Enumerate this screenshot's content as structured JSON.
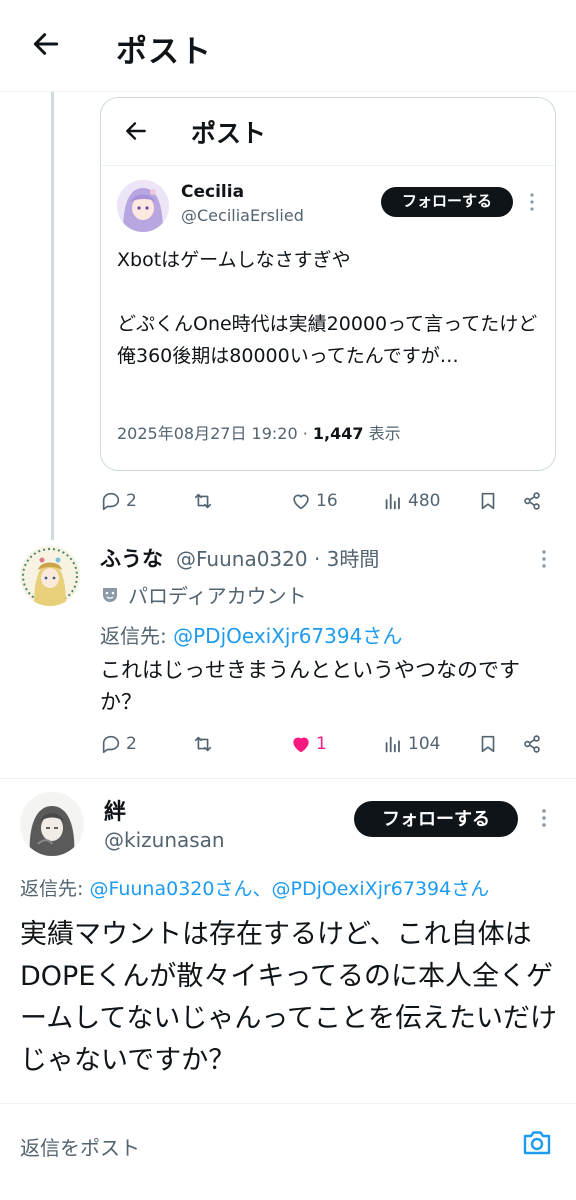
{
  "header": {
    "title": "ポスト"
  },
  "quoted": {
    "screen_title": "ポスト",
    "author_name": "Cecilia",
    "author_handle": "@CeciliaErslied",
    "follow_label": "フォローする",
    "text": "Xbotはゲームしなさすぎや\n\nどぷくんOne時代は実績20000って言ってたけど\n俺360後期は80000いってたんですが…",
    "date": "2025年08月27日 19:20 · ",
    "views": "1,447",
    "views_label": " 表示",
    "stats": {
      "replies": "2",
      "likes": "16",
      "views": "480"
    }
  },
  "reply1": {
    "name": "ふうな",
    "handle_time": "@Fuuna0320 · 3時間",
    "parody_label": "パロディアカウント",
    "reply_prefix": "返信先: ",
    "reply_to": "@PDjOexiXjr67394さん",
    "text": "これはじっせきまうんとというやつなのですか？",
    "stats": {
      "replies": "2",
      "likes": "1",
      "views": "104"
    }
  },
  "focused": {
    "name": "絆",
    "handle": "@kizunasan",
    "follow_label": "フォローする",
    "reply_prefix": "返信先: ",
    "reply_to_1": "@Fuuna0320さん",
    "reply_sep": "、",
    "reply_to_2": "@PDjOexiXjr67394さん",
    "text": "実績マウントは存在するけど、これ自体はDOPEくんが散々イキってるのに本人全くゲームしてないじゃんってことを伝えたいだけじゃないですか？"
  },
  "composer": {
    "placeholder": "返信をポスト"
  },
  "colors": {
    "accent": "#1d9bf0",
    "like_active": "#f91880",
    "text": "#0f1419",
    "muted": "#536471"
  },
  "icons": [
    "back-arrow-icon",
    "kebab-icon",
    "reply-icon",
    "repost-icon",
    "like-icon",
    "views-icon",
    "bookmark-icon",
    "share-icon",
    "parody-mask-icon",
    "camera-icon"
  ]
}
